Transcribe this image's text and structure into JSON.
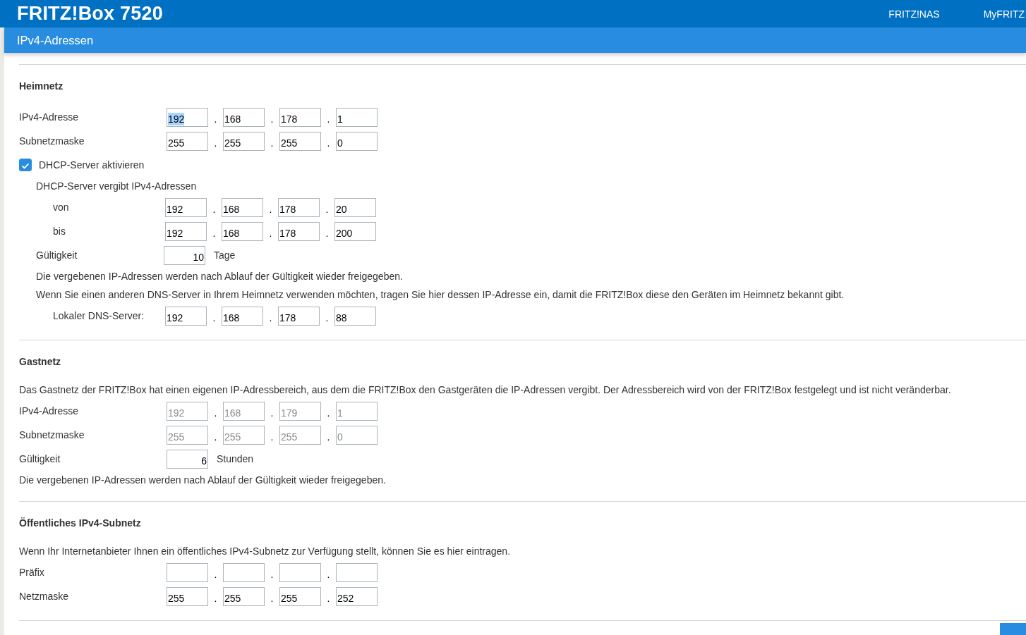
{
  "header": {
    "title": "FRITZ!Box 7520",
    "nav": [
      "FRITZ!NAS",
      "MyFRITZ"
    ]
  },
  "page_title": "IPv4-Adressen",
  "sections": [
    {
      "heading": "Heimnetz",
      "rows": [
        {
          "kind": "ip",
          "label": "IPv4-Adresse",
          "separator": ".",
          "disabled": false,
          "octets": [
            {
              "value": "192",
              "highlighted": true
            },
            {
              "value": "168",
              "highlighted": false
            },
            {
              "value": "178",
              "highlighted": false
            },
            {
              "value": "1",
              "highlighted": false
            }
          ]
        },
        {
          "kind": "ip",
          "label": "Subnetzmaske",
          "separator": ".",
          "disabled": false,
          "octets": [
            {
              "value": "255",
              "highlighted": false
            },
            {
              "value": "255",
              "highlighted": false
            },
            {
              "value": "255",
              "highlighted": false
            },
            {
              "value": "0",
              "highlighted": false
            }
          ]
        },
        {
          "kind": "check",
          "label": "DHCP-Server aktivieren",
          "checked": true,
          "children": [
            {
              "kind": "text",
              "label": "DHCP-Server vergibt IPv4-Adressen",
              "children": [
                {
                  "kind": "ip",
                  "label": "von",
                  "separator": ".",
                  "disabled": false,
                  "octets": [
                    {
                      "value": "192",
                      "highlighted": false
                    },
                    {
                      "value": "168",
                      "highlighted": false
                    },
                    {
                      "value": "178",
                      "highlighted": false
                    },
                    {
                      "value": "20",
                      "highlighted": false
                    }
                  ]
                },
                {
                  "kind": "ip",
                  "label": "bis",
                  "separator": ".",
                  "disabled": false,
                  "octets": [
                    {
                      "value": "192",
                      "highlighted": false
                    },
                    {
                      "value": "168",
                      "highlighted": false
                    },
                    {
                      "value": "178",
                      "highlighted": false
                    },
                    {
                      "value": "200",
                      "highlighted": false
                    }
                  ]
                }
              ]
            },
            {
              "kind": "number",
              "label": "Gültigkeit",
              "value": "10",
              "unit": "Tage"
            },
            {
              "kind": "text",
              "label": "Die vergebenen IP-Adressen werden nach Ablauf der Gültigkeit wieder freigegeben."
            },
            {
              "kind": "text",
              "label": "Wenn Sie einen anderen DNS-Server in Ihrem Heimnetz verwenden möchten, tragen Sie hier dessen IP-Adresse ein, damit die FRITZ!Box diese den Geräten im Heimnetz bekannt gibt.",
              "children": [
                {
                  "kind": "ip",
                  "label": "Lokaler DNS-Server:",
                  "separator": ".",
                  "disabled": false,
                  "octets": [
                    {
                      "value": "192",
                      "highlighted": false
                    },
                    {
                      "value": "168",
                      "highlighted": false
                    },
                    {
                      "value": "178",
                      "highlighted": false
                    },
                    {
                      "value": "88",
                      "highlighted": false
                    }
                  ]
                }
              ]
            }
          ]
        }
      ]
    },
    {
      "heading": "Gastnetz",
      "rows": [
        {
          "kind": "text",
          "label": "Das Gastnetz der FRITZ!Box hat einen eigenen IP-Adressbereich, aus dem die FRITZ!Box den Gastgeräten die IP-Adressen vergibt. Der Adressbereich wird von der FRITZ!Box festgelegt und ist nicht veränderbar."
        },
        {
          "kind": "ip",
          "label": "IPv4-Adresse",
          "separator": ".",
          "disabled": true,
          "octets": [
            {
              "value": "192",
              "highlighted": false
            },
            {
              "value": "168",
              "highlighted": false
            },
            {
              "value": "179",
              "highlighted": false
            },
            {
              "value": "1",
              "highlighted": false
            }
          ]
        },
        {
          "kind": "ip",
          "label": "Subnetzmaske",
          "separator": ".",
          "disabled": true,
          "octets": [
            {
              "value": "255",
              "highlighted": false
            },
            {
              "value": "255",
              "highlighted": false
            },
            {
              "value": "255",
              "highlighted": false
            },
            {
              "value": "0",
              "highlighted": false
            }
          ]
        },
        {
          "kind": "number",
          "label": "Gültigkeit",
          "value": "6",
          "unit": "Stunden"
        },
        {
          "kind": "text",
          "label": "Die vergebenen IP-Adressen werden nach Ablauf der Gültigkeit wieder freigegeben."
        }
      ]
    },
    {
      "heading": "Öffentliches IPv4-Subnetz",
      "rows": [
        {
          "kind": "text",
          "label": "Wenn Ihr Internetanbieter Ihnen ein öffentliches IPv4-Subnetz zur Verfügung stellt, können Sie es hier eintragen."
        },
        {
          "kind": "blank_ip",
          "label": "Präfix",
          "separators": [
            ".",
            ".",
            "."
          ]
        },
        {
          "kind": "ip",
          "label": "Netzmaske",
          "separator": ".",
          "disabled": false,
          "octets": [
            {
              "value": "255",
              "highlighted": false
            },
            {
              "value": "255",
              "highlighted": false
            },
            {
              "value": "255",
              "highlighted": false
            },
            {
              "value": "252",
              "highlighted": false
            }
          ]
        }
      ]
    }
  ]
}
